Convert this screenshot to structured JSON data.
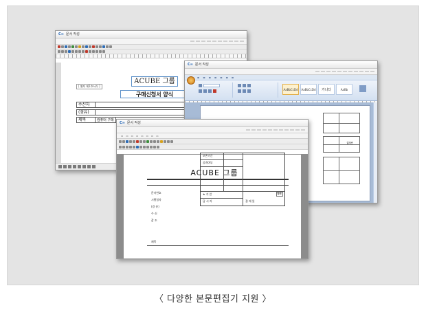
{
  "caption": "〈 다양한 본문편집기 지원 〉",
  "window1": {
    "title": "문서 작성",
    "doc_title": "ACUBE 그룹",
    "memo_label": "[ 별지 제1호서식 ]",
    "form_title": "구매신청서 양식",
    "row_recipient": "수신자",
    "row_via": "(경유)",
    "row_subject": "제목",
    "subject_tag": "컴퓨터 구매"
  },
  "window2": {
    "title": "문서 작성",
    "styles": [
      "AaBbCcDd",
      "AaBbCcDd",
      "가나다",
      "AaBb"
    ],
    "cell_text": "결재란"
  },
  "window3": {
    "title": "문서 작성",
    "doc_title": "ACUBE 그룹",
    "field_doc_no": "문서번호",
    "field_date": "시행일자",
    "field_via": "(경 유)",
    "field_recipient": "수 신",
    "field_ref": "참 조",
    "field_subject": "제목",
    "grid_keep": "보존기간",
    "grid_public": "공개여부",
    "grid_approve": "★ 기 안",
    "grid_manager": "담 시 자",
    "grid_sign": "결 재 일",
    "stamp": "합조"
  }
}
